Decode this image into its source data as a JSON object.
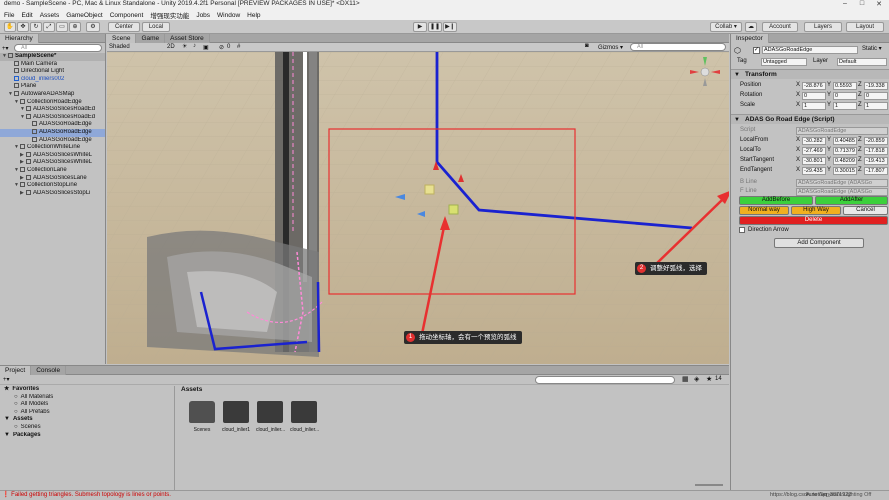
{
  "window": {
    "title": "demo - SampleScene - PC, Mac & Linux Standalone - Unity 2019.4.2f1 Personal [PREVIEW PACKAGES IN USE]* <DX11>"
  },
  "menu": [
    "File",
    "Edit",
    "Assets",
    "GameObject",
    "Component",
    "增强现实功能",
    "Jobs",
    "Window",
    "Help"
  ],
  "toolbar": {
    "center": "Center",
    "local": "Local",
    "collab": "Collab ▾",
    "account": "Account",
    "layers": "Layers",
    "layout": "Layout"
  },
  "hierarchy": {
    "tab": "Hierarchy",
    "create": "+▾",
    "search_placeholder": "All",
    "items": [
      {
        "label": "SampleScene*",
        "depth": 0,
        "kind": "scene"
      },
      {
        "label": "Main Camera",
        "depth": 1
      },
      {
        "label": "Directional Light",
        "depth": 1
      },
      {
        "label": "cloud_inliers002",
        "depth": 1,
        "highlight": true
      },
      {
        "label": "Plane",
        "depth": 1
      },
      {
        "label": "AutowareADASMap",
        "depth": 1
      },
      {
        "label": "CollectionRoadEdge",
        "depth": 2
      },
      {
        "label": "ADASGoSlicesRoadEd",
        "depth": 3
      },
      {
        "label": "ADASGoSlicesRoadEd",
        "depth": 3
      },
      {
        "label": "ADASGoRoadEdge",
        "depth": 4
      },
      {
        "label": "ADASGoRoadEdge",
        "depth": 4,
        "selected": true
      },
      {
        "label": "ADASGoRoadEdge",
        "depth": 4
      },
      {
        "label": "CollectionWhiteLine",
        "depth": 2
      },
      {
        "label": "ADASGoSlicesWhiteL",
        "depth": 3
      },
      {
        "label": "ADASGoSlicesWhiteL",
        "depth": 3
      },
      {
        "label": "CollectionLane",
        "depth": 2
      },
      {
        "label": "ADASGoSlicesLane",
        "depth": 3
      },
      {
        "label": "CollectionStopLine",
        "depth": 2
      },
      {
        "label": "ADASGoSlicesStopLi",
        "depth": 3
      }
    ]
  },
  "scene": {
    "tabs": [
      "Scene",
      "Game",
      "Asset Store"
    ],
    "shading": "Shaded",
    "mode2d": "2D",
    "gizmos": "Gizmos ▾",
    "search_placeholder": "All",
    "fx_count": "0"
  },
  "inspector": {
    "tab": "Inspector",
    "object_name": "ADASGoRoadEdge",
    "static": "Static ▾",
    "tag_label": "Tag",
    "tag": "Untagged",
    "layer_label": "Layer",
    "layer": "Default",
    "transform": {
      "title": "Transform",
      "position": {
        "label": "Position",
        "x": "-28.876",
        "y": "0.5593",
        "z": "-19.338"
      },
      "rotation": {
        "label": "Rotation",
        "x": "0",
        "y": "0",
        "z": "0"
      },
      "scale": {
        "label": "Scale",
        "x": "1",
        "y": "1",
        "z": "1"
      }
    },
    "script": {
      "title": "ADAS Go Road Edge (Script)",
      "script_label": "Script",
      "script_value": "ADASGoRoadEdge",
      "fields": [
        {
          "label": "LocalFrom",
          "x": "-30.282",
          "y": "0.40485",
          "z": "-20.859"
        },
        {
          "label": "LocalTo",
          "x": "-27.469",
          "y": "0.71379",
          "z": "-17.818"
        },
        {
          "label": "StartTangent",
          "x": "-30.801",
          "y": "0.48209",
          "z": "-19.413"
        },
        {
          "label": "EndTangent",
          "x": "-29.435",
          "y": "0.30015",
          "z": "-17.807"
        }
      ],
      "b_line_label": "B Line",
      "b_line": "ADASGoRoadEdge (ADASGo",
      "f_line_label": "F Line",
      "f_line": "ADASGoRoadEdge (ADASGo",
      "add_before": "AddBefore",
      "add_after": "AddAfter",
      "normal_way": "Normal way",
      "high_way": "High Way",
      "cancel": "Cancel",
      "delete": "Delete",
      "direction_arrow": "Direction Arrow"
    },
    "add_component": "Add Component"
  },
  "project": {
    "tabs": [
      "Project",
      "Console"
    ],
    "create": "+▾",
    "tree": [
      {
        "label": "Favorites",
        "depth": 0,
        "bold": true
      },
      {
        "label": "All Materials",
        "depth": 1
      },
      {
        "label": "All Models",
        "depth": 1
      },
      {
        "label": "All Prefabs",
        "depth": 1
      },
      {
        "label": "Assets",
        "depth": 0,
        "bold": true
      },
      {
        "label": "Scenes",
        "depth": 1
      },
      {
        "label": "Packages",
        "depth": 0,
        "bold": true
      }
    ],
    "breadcrumb": "Assets",
    "count": "14",
    "assets": [
      "Scenes",
      "cloud_inlier1",
      "cloud_inlier...",
      "cloud_inlier..."
    ]
  },
  "annotations": [
    {
      "number": "1",
      "text": "拖动坐标轴，会有一个预览的弧线"
    },
    {
      "number": "2",
      "text": "调整好弧线，选择"
    }
  ],
  "status": {
    "message": "Failed getting triangles. Submesh topology is lines or points.",
    "right": "Auto Generate Lighting Off",
    "watermark": "https://blog.csdn.net/qq_3871922"
  },
  "colors": {
    "accent_green": "#3cd03c",
    "warning_orange": "#f0b020",
    "delete_red": "#e02020",
    "road_edge_blue": "#1a22d0",
    "selection_red": "#e83030"
  }
}
